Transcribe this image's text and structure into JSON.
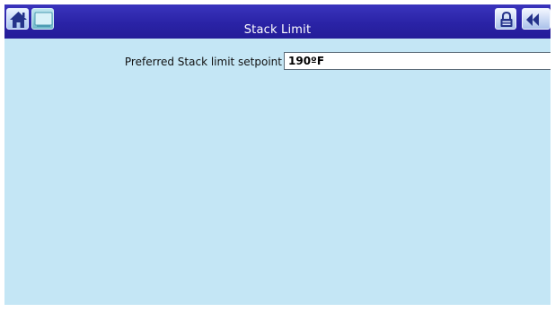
{
  "header": {
    "title": "Stack Limit",
    "home_icon": "home-icon",
    "screen_icon": "screen-icon",
    "lock_icon": "lock-icon",
    "back_icon": "back-arrow-icon"
  },
  "setting": {
    "label": "Preferred Stack limit setpoint",
    "value": "190ºF"
  },
  "colors": {
    "header": "#2a23a6",
    "background": "#c4e6f5"
  }
}
